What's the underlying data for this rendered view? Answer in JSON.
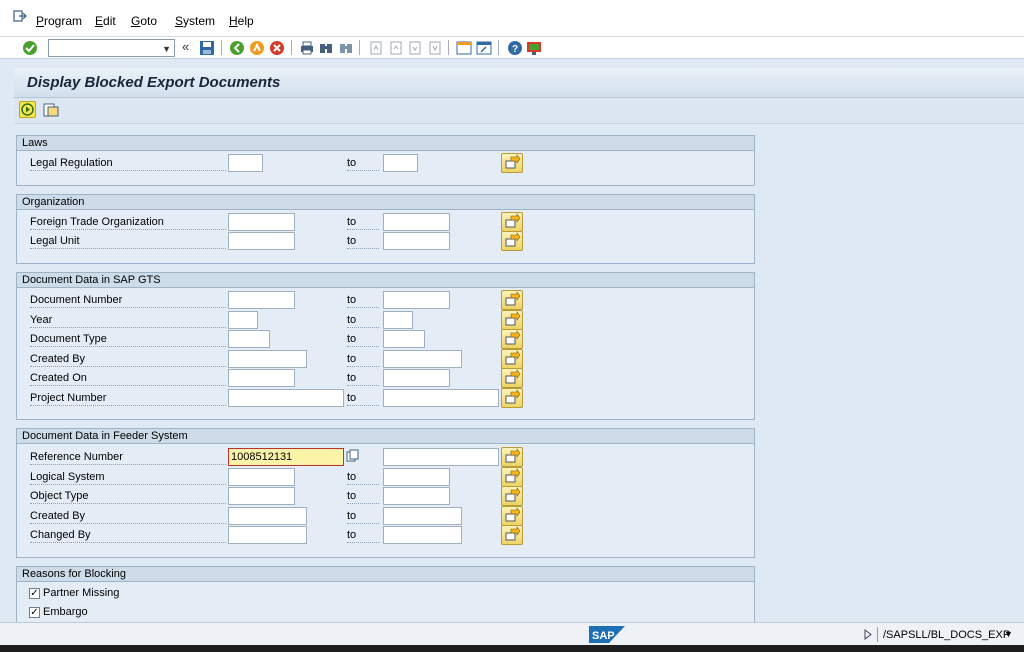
{
  "menu": {
    "items": [
      {
        "u": "P",
        "rest": "rogram"
      },
      {
        "u": "E",
        "rest": "dit"
      },
      {
        "u": "G",
        "rest": "oto"
      },
      {
        "u": "S",
        "rest": "ystem"
      },
      {
        "u": "H",
        "rest": "elp"
      }
    ]
  },
  "toolbar": {
    "command_value": "",
    "collapse_label": "«"
  },
  "page": {
    "title": "Display Blocked Export Documents"
  },
  "sections": {
    "laws": {
      "title": "Laws",
      "rows": [
        {
          "label": "Legal Regulation",
          "to": "to"
        }
      ]
    },
    "organization": {
      "title": "Organization",
      "rows": [
        {
          "label": "Foreign Trade Organization",
          "to": "to"
        },
        {
          "label": "Legal Unit",
          "to": "to"
        }
      ]
    },
    "gts": {
      "title": "Document Data in SAP GTS",
      "rows": [
        {
          "label": "Document Number",
          "to": "to"
        },
        {
          "label": "Year",
          "to": "to"
        },
        {
          "label": "Document Type",
          "to": "to"
        },
        {
          "label": "Created By",
          "to": "to"
        },
        {
          "label": "Created On",
          "to": "to"
        },
        {
          "label": "Project Number",
          "to": "to"
        }
      ]
    },
    "feeder": {
      "title": "Document Data in Feeder System",
      "rows": [
        {
          "label": "Reference Number",
          "value": "1008512131"
        },
        {
          "label": "Logical System",
          "to": "to"
        },
        {
          "label": "Object Type",
          "to": "to"
        },
        {
          "label": "Created By",
          "to": "to"
        },
        {
          "label": "Changed By",
          "to": "to"
        }
      ]
    },
    "reasons": {
      "title": "Reasons for Blocking",
      "checks": [
        {
          "label": "Partner Missing",
          "checked": true,
          "mark": "✓"
        },
        {
          "label": "Embargo",
          "checked": true,
          "mark": "✓"
        }
      ]
    }
  },
  "status": {
    "logo_text": "SAP",
    "transaction": "/SAPSLL/BL_DOCS_EXP"
  },
  "colors": {
    "accent_yellow": "#f6e94a",
    "frame_bg": "#e4edf6",
    "active_field": "#fbf3a8"
  }
}
